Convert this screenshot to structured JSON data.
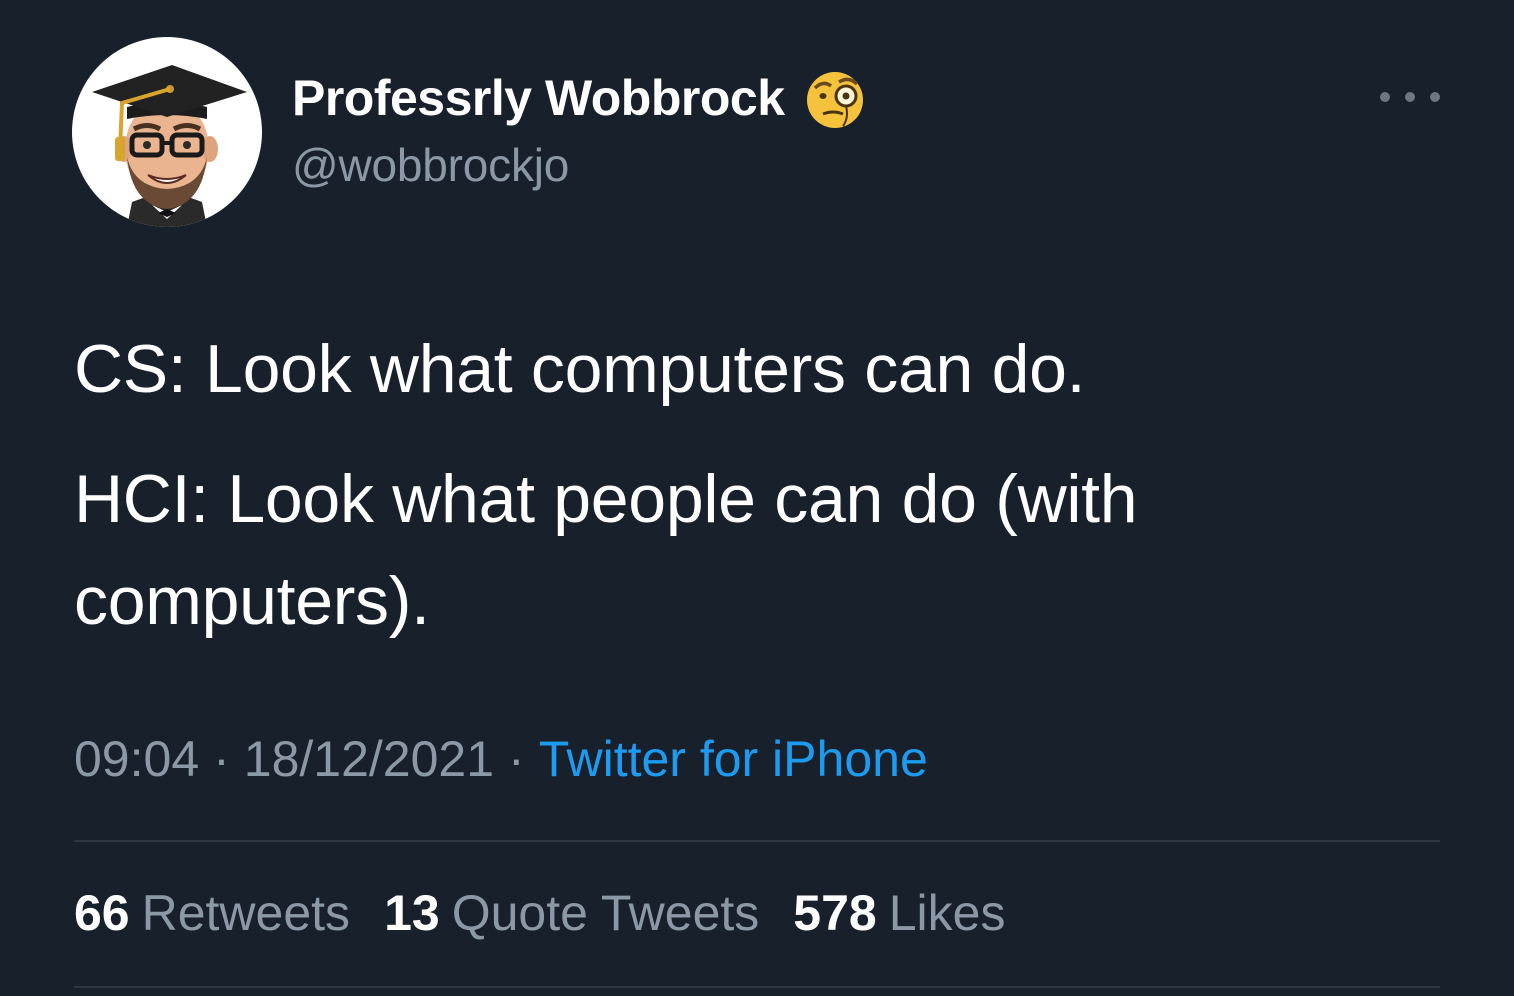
{
  "author": {
    "display_name": "Professrly Wobbrock",
    "name_emoji": "🧐",
    "handle": "@wobbrockjo",
    "avatar": "bitmoji-avatar-graduation-cap"
  },
  "tweet": {
    "line1": "CS: Look what computers can do.",
    "line2": "HCI: Look what people can do (with computers)."
  },
  "meta": {
    "time": "09:04",
    "separator": "·",
    "date": "18/12/2021",
    "source": "Twitter for iPhone"
  },
  "stats": {
    "retweets_count": "66",
    "retweets_label": "Retweets",
    "quotes_count": "13",
    "quotes_label": "Quote Tweets",
    "likes_count": "578",
    "likes_label": "Likes"
  },
  "icons": {
    "more": "more-horizontal-icon"
  },
  "colors": {
    "background": "#18202b",
    "text": "#ffffff",
    "muted": "#8b98a5",
    "link": "#1d9bf0",
    "divider": "#2f3740"
  }
}
